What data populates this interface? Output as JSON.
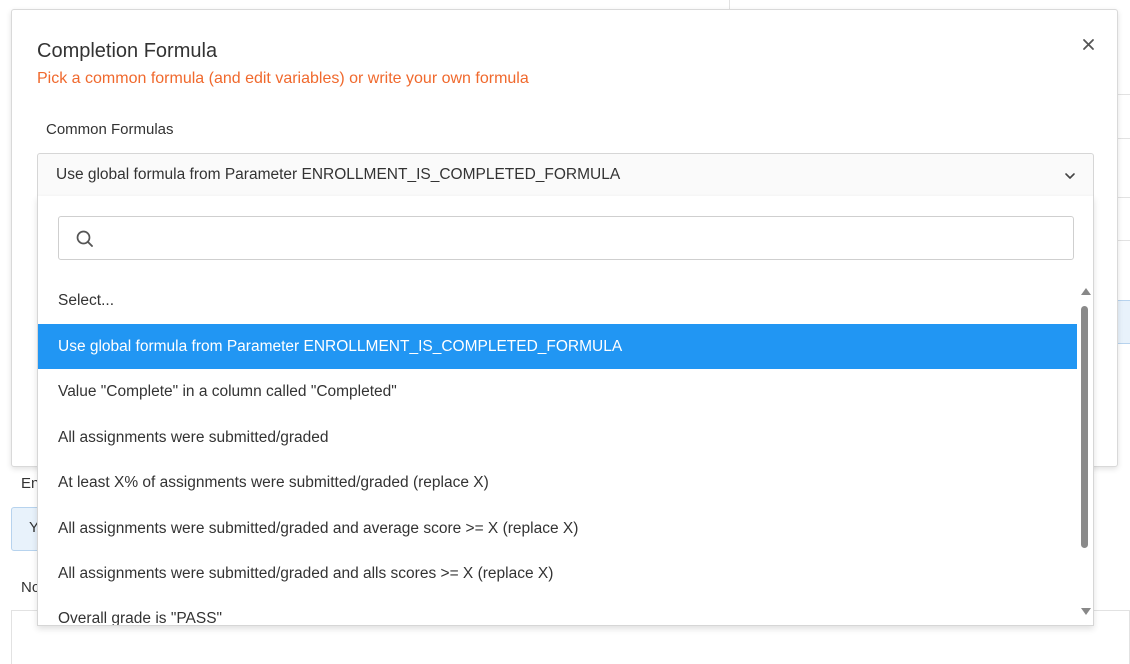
{
  "background": {
    "text_en": "En",
    "text_y": "Y",
    "text_no": "No"
  },
  "modal": {
    "title": "Completion Formula",
    "subtitle": "Pick a common formula (and edit variables) or write your own formula",
    "close_label": "×",
    "field_label": "Common Formulas",
    "selected_value": "Use global formula from Parameter ENROLLMENT_IS_COMPLETED_FORMULA",
    "search": {
      "value": "",
      "placeholder": ""
    },
    "options": [
      {
        "label": "Select...",
        "selected": false
      },
      {
        "label": "Use global formula from Parameter ENROLLMENT_IS_COMPLETED_FORMULA",
        "selected": true
      },
      {
        "label": "Value \"Complete\" in a column called \"Completed\"",
        "selected": false
      },
      {
        "label": "All assignments were submitted/graded",
        "selected": false
      },
      {
        "label": "At least X% of assignments were submitted/graded (replace X)",
        "selected": false
      },
      {
        "label": "All assignments were submitted/graded and average score >= X (replace X)",
        "selected": false
      },
      {
        "label": "All assignments were submitted/graded and alls scores >= X (replace X)",
        "selected": false
      },
      {
        "label": "Overall grade is \"PASS\"",
        "selected": false
      }
    ]
  },
  "colors": {
    "accent": "#f0692d",
    "selected_bg": "#2196f3",
    "selected_text": "#ffffff"
  }
}
